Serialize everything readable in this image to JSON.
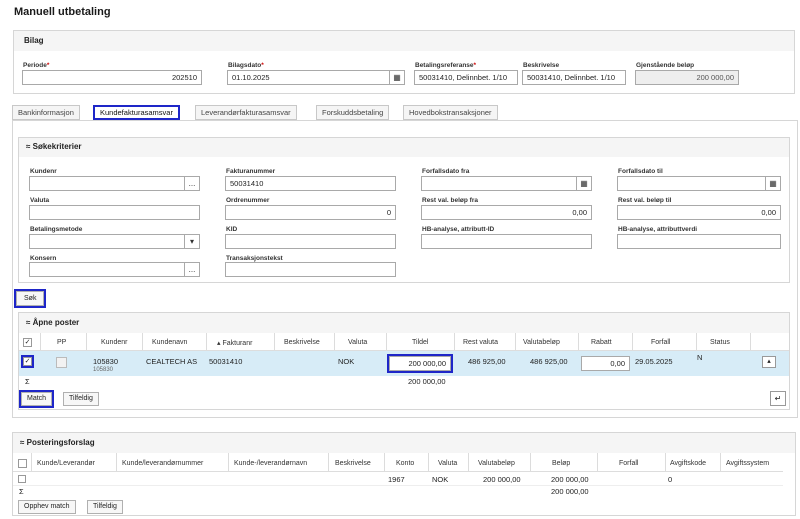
{
  "page_title": "Manuell utbetaling",
  "bilag": {
    "title": "Bilag",
    "periode_label": "Periode",
    "periode_value": "202510",
    "bilagsdato_label": "Bilagsdato",
    "bilagsdato_value": "01.10.2025",
    "betref_label": "Betalingsreferanse",
    "betref_value": "50031410, Delinnbet. 1/10",
    "beskrivelse_label": "Beskrivelse",
    "beskrivelse_value": "50031410, Delinnbet. 1/10",
    "gjenstaende_label": "Gjenstående beløp",
    "gjenstaende_value": "200 000,00",
    "required_mark": "*"
  },
  "tabs": [
    "Bankinformasjon",
    "Kundefakturasamsvar",
    "Leverandørfakturasamsvar",
    "Forskuddsbetaling",
    "Hovedbokstransaksjoner"
  ],
  "search": {
    "title": "Søkekriterier",
    "kundenr_label": "Kundenr",
    "kundenr_value": "",
    "fakturanummer_label": "Fakturanummer",
    "fakturanummer_value": "50031410",
    "forfall_fra_label": "Forfallsdato fra",
    "forfall_til_label": "Forfallsdato til",
    "valuta_label": "Valuta",
    "ordrenummer_label": "Ordrenummer",
    "ordrenummer_value": "0",
    "rest_fra_label": "Rest val. beløp fra",
    "rest_fra_value": "0,00",
    "rest_til_label": "Rest val. beløp til",
    "rest_til_value": "0,00",
    "betalingsmetode_label": "Betalingsmetode",
    "kid_label": "KID",
    "hb_id_label": "HB-analyse, attributt-ID",
    "hb_verdi_label": "HB-analyse, attributtverdi",
    "konsern_label": "Konsern",
    "transtekst_label": "Transaksjonstekst",
    "sok_button": "Søk",
    "ellipsis": "..."
  },
  "open_items": {
    "title": "Åpne poster",
    "columns": [
      "PP",
      "Kundenr",
      "Kundenavn",
      "Fakturanr",
      "Beskrivelse",
      "Valuta",
      "Tildel",
      "Rest valuta",
      "Valutabeløp",
      "Rabatt",
      "Forfall",
      "Status"
    ],
    "row": {
      "kundenr": "105830",
      "kundenr_sub": "105830",
      "kundenavn": "CEALTECH AS",
      "fakturanr": "50031410",
      "valuta": "NOK",
      "tildel": "200 000,00",
      "rest_valuta": "486 925,00",
      "valutabelop": "486 925,00",
      "rabatt": "0,00",
      "forfall": "29.05.2025",
      "status": "N"
    },
    "sum_symbol": "Σ",
    "sum_tildel": "200 000,00",
    "match_button": "Match",
    "tilfeldig_button": "Tilfeldig"
  },
  "posting": {
    "title": "Posteringsforslag",
    "columns": [
      "Kunde/Leverandør",
      "Kunde/leverandørnummer",
      "Kunde-/leverandørnavn",
      "Beskrivelse",
      "Konto",
      "Valuta",
      "Valutabeløp",
      "Beløp",
      "Forfall",
      "Avgiftskode",
      "Avgiftssystem"
    ],
    "row": {
      "konto": "1967",
      "valuta": "NOK",
      "valutabelop": "200 000,00",
      "belop": "200 000,00",
      "avgiftskode": "0"
    },
    "sum_symbol": "Σ",
    "sum_belop": "200 000,00",
    "opphev_button": "Opphev match",
    "tilfeldig_button": "Tilfeldig"
  },
  "colors": {
    "accent": "#1e26c8",
    "selected_row": "#d7ecf7"
  }
}
